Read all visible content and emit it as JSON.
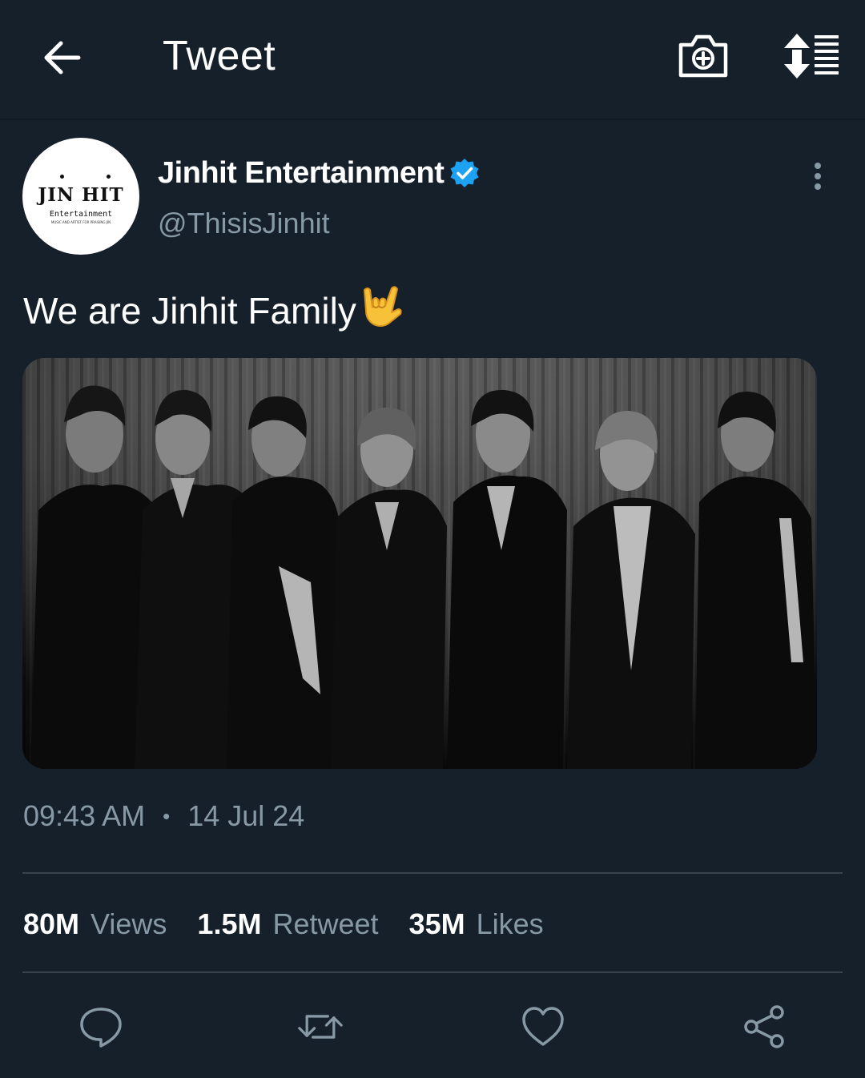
{
  "header": {
    "title": "Tweet",
    "back_icon": "arrow-left-icon",
    "camera_icon": "camera-add-icon",
    "sort_icon": "sort-list-icon"
  },
  "tweet": {
    "author": {
      "name": "Jinhit Entertainment",
      "handle": "@ThisisJinhit",
      "verified": true,
      "avatar_logo": {
        "main": "JIN HIT",
        "sub": "Entertainment",
        "tiny": "MUSIC AND ARTIST FOR PRAISING JIN"
      }
    },
    "text": "We are Jinhit Family",
    "emoji": "love-you-gesture-hand",
    "time": "09:43 AM",
    "separator": "•",
    "date": "14 Jul 24"
  },
  "stats": [
    {
      "value": "80M",
      "label": "Views"
    },
    {
      "value": "1.5M",
      "label": "Retweet"
    },
    {
      "value": "35M",
      "label": "Likes"
    }
  ],
  "actions": [
    {
      "name": "reply",
      "icon": "comment-icon"
    },
    {
      "name": "retweet",
      "icon": "retweet-icon"
    },
    {
      "name": "like",
      "icon": "heart-icon"
    },
    {
      "name": "share",
      "icon": "share-icon"
    }
  ],
  "colors": {
    "background": "#15202b",
    "text": "#ffffff",
    "secondary": "#8899a6",
    "divider": "#38444d",
    "verified": "#1da1f2"
  }
}
